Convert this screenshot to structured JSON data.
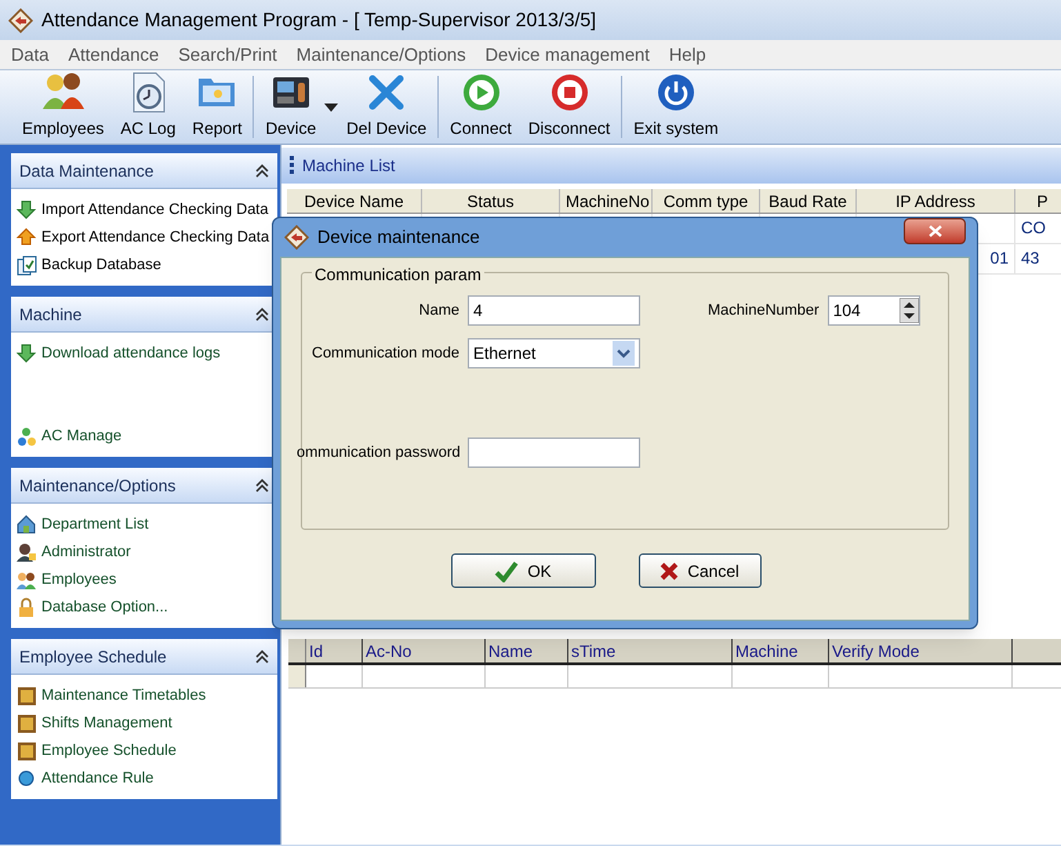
{
  "window": {
    "title": "Attendance Management Program - [ Temp-Supervisor 2013/3/5]"
  },
  "menu": [
    "Data",
    "Attendance",
    "Search/Print",
    "Maintenance/Options",
    "Device management",
    "Help"
  ],
  "toolbar": [
    {
      "label": "Employees",
      "kind": "people",
      "dropdown": false
    },
    {
      "label": "AC Log",
      "kind": "clock",
      "dropdown": false
    },
    {
      "label": "Report",
      "kind": "folder",
      "dropdown": false
    },
    {
      "label": "Device",
      "kind": "device",
      "dropdown": true
    },
    {
      "label": "Del Device",
      "kind": "cross",
      "dropdown": false
    },
    {
      "label": "Connect",
      "kind": "play",
      "dropdown": false
    },
    {
      "label": "Disconnect",
      "kind": "stop",
      "dropdown": false
    },
    {
      "label": "Exit system",
      "kind": "power",
      "dropdown": false
    }
  ],
  "sidebar": [
    {
      "title": "Data Maintenance",
      "expanded": true,
      "items": [
        {
          "label": "Import Attendance Checking Data",
          "kind": "down"
        },
        {
          "label": "Export Attendance Checking Data",
          "kind": "up"
        },
        {
          "label": "Backup Database",
          "kind": "backup"
        }
      ]
    },
    {
      "title": "Machine",
      "expanded": true,
      "items": [
        {
          "label": "Download attendance logs",
          "kind": "down"
        },
        {
          "label": "AC Manage",
          "kind": "dots"
        }
      ]
    },
    {
      "title": "Maintenance/Options",
      "expanded": true,
      "items": [
        {
          "label": "Department List",
          "kind": "house"
        },
        {
          "label": "Administrator",
          "kind": "admin"
        },
        {
          "label": "Employees",
          "kind": "people"
        },
        {
          "label": "Database Option...",
          "kind": "lock"
        }
      ]
    },
    {
      "title": "Employee Schedule",
      "expanded": true,
      "items": [
        {
          "label": "Maintenance Timetables",
          "kind": "tile"
        },
        {
          "label": "Shifts Management",
          "kind": "tile"
        },
        {
          "label": "Employee Schedule",
          "kind": "tile"
        },
        {
          "label": "Attendance Rule",
          "kind": "ball"
        }
      ]
    }
  ],
  "machine_list": {
    "title": "Machine List",
    "columns": [
      "Device Name",
      "Status",
      "MachineNo",
      "Comm type",
      "Baud Rate",
      "IP Address",
      "P"
    ],
    "rows": [
      {
        "column_7": "CO"
      },
      {
        "ip_address": "01",
        "column_7": "43"
      }
    ]
  },
  "log_table": {
    "columns": [
      "Id",
      "Ac-No",
      "Name",
      "sTime",
      "Machine",
      "Verify Mode"
    ]
  },
  "dialog": {
    "title": "Device maintenance",
    "group": "Communication param",
    "name": {
      "label": "Name",
      "value": "4"
    },
    "machine_number": {
      "label": "MachineNumber",
      "value": "104"
    },
    "mode": {
      "label": "Communication mode",
      "value": "Ethernet"
    },
    "password": {
      "label": "ommunication password"
    },
    "buttons": [
      {
        "label": "OK",
        "kind": "ok"
      },
      {
        "label": "Cancel",
        "kind": "cancel"
      }
    ]
  }
}
